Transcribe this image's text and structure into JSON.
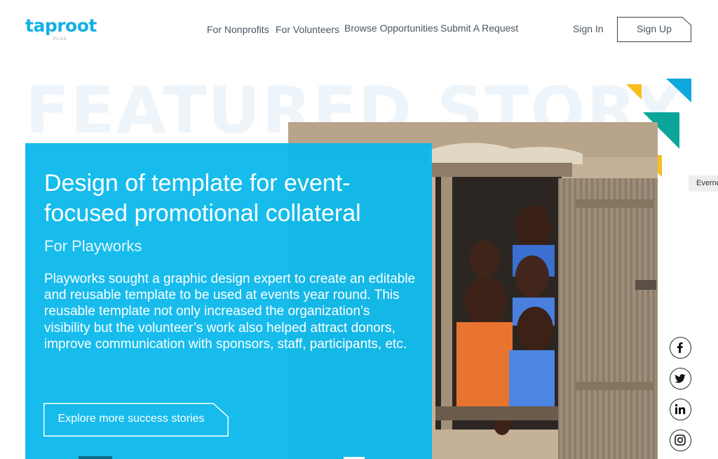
{
  "header": {
    "logo_text": "taproot",
    "logo_subtext": "PLUS",
    "nav": [
      {
        "label": "For Nonprofits"
      },
      {
        "label": "For Volunteers"
      },
      {
        "label": "Browse Opportunities"
      },
      {
        "label": "Submit A Request"
      }
    ],
    "sign_in": "Sign In",
    "sign_up": "Sign Up"
  },
  "watermark": "FEATURED STORY",
  "story": {
    "title": "Design of template for event-focused promotional collateral",
    "org": "For Playworks",
    "description": "Playworks sought a graphic design expert to create an editable and reusable template to be used at events year round. This reusable template not only increased the organization’s visibility but the volunteer’s work also helped attract donors, improve communication with sponsors, staff, participants, etc.",
    "cta": "Explore more success stories"
  },
  "evernote_tab": "Everno",
  "social": [
    {
      "icon": "facebook-icon"
    },
    {
      "icon": "twitter-icon"
    },
    {
      "icon": "linkedin-icon"
    },
    {
      "icon": "instagram-icon"
    }
  ],
  "colors": {
    "brand_blue": "#13b0e6",
    "card_blue": "#08b8ec",
    "triangle_yellow": "#f6bf1c",
    "triangle_teal": "#0ba59a",
    "triangle_blue": "#0fa7de"
  }
}
